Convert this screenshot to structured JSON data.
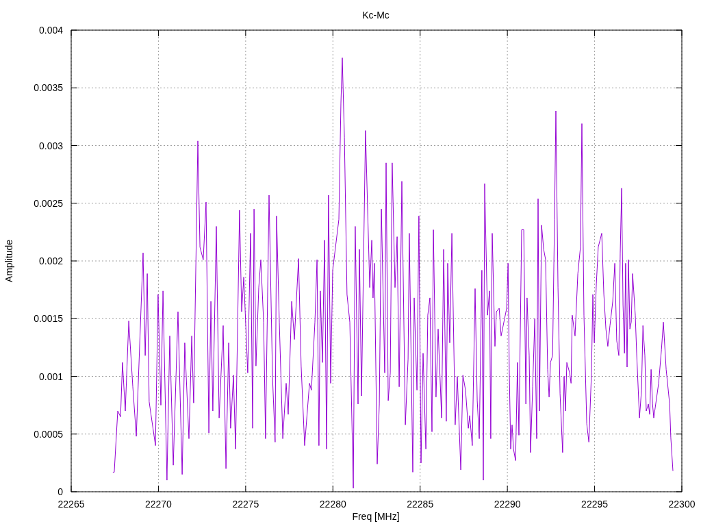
{
  "chart_data": {
    "type": "line",
    "title": "Kc-Mc",
    "xlabel": "Freq [MHz]",
    "ylabel": "Amplitude",
    "grid": true,
    "xlim": [
      22265,
      22300
    ],
    "ylim": [
      0,
      0.004
    ],
    "xticks": [
      22265,
      22270,
      22275,
      22280,
      22285,
      22290,
      22295,
      22300
    ],
    "yticks": [
      0,
      0.0005,
      0.001,
      0.0015,
      0.002,
      0.0025,
      0.003,
      0.0035,
      0.004
    ],
    "x": [
      22267.39,
      22267.47,
      22267.67,
      22267.83,
      22267.94,
      22268.1,
      22268.3,
      22268.53,
      22268.73,
      22269.12,
      22269.24,
      22269.36,
      22269.47,
      22269.83,
      22269.98,
      22270.14,
      22270.26,
      22270.49,
      22270.65,
      22270.85,
      22271.12,
      22271.36,
      22271.51,
      22271.75,
      22271.91,
      22272.02,
      22272.26,
      22272.38,
      22272.57,
      22272.73,
      22272.89,
      22273.01,
      22273.12,
      22273.32,
      22273.48,
      22273.71,
      22273.87,
      22274.03,
      22274.14,
      22274.3,
      22274.42,
      22274.65,
      22274.77,
      22274.89,
      22275.12,
      22275.28,
      22275.4,
      22275.48,
      22275.59,
      22275.75,
      22275.87,
      22276.03,
      22276.14,
      22276.34,
      22276.54,
      22276.69,
      22276.77,
      22276.93,
      22277.13,
      22277.32,
      22277.44,
      22277.64,
      22277.79,
      22278.03,
      22278.18,
      22278.38,
      22278.66,
      22278.77,
      22278.97,
      22279.09,
      22279.2,
      22279.28,
      22279.4,
      22279.52,
      22279.64,
      22279.75,
      22279.87,
      22279.99,
      22280.34,
      22280.46,
      22280.54,
      22280.66,
      22280.81,
      22280.97,
      22281.17,
      22281.28,
      22281.44,
      22281.52,
      22281.64,
      22281.87,
      22282.11,
      22282.23,
      22282.3,
      22282.38,
      22282.54,
      22282.66,
      22282.78,
      22282.97,
      22283.05,
      22283.17,
      22283.29,
      22283.4,
      22283.56,
      22283.68,
      22283.8,
      22283.95,
      22284.15,
      22284.31,
      22284.38,
      22284.58,
      22284.66,
      22284.82,
      22284.93,
      22285.05,
      22285.17,
      22285.33,
      22285.44,
      22285.56,
      22285.68,
      22285.76,
      22285.91,
      22286.03,
      22286.23,
      22286.35,
      22286.5,
      22286.58,
      22286.7,
      22286.82,
      22287.01,
      22287.13,
      22287.33,
      22287.45,
      22287.6,
      22287.76,
      22287.84,
      22287.99,
      22288.15,
      22288.27,
      22288.39,
      22288.54,
      22288.62,
      22288.7,
      22288.86,
      22288.98,
      22289.05,
      22289.13,
      22289.29,
      22289.37,
      22289.53,
      22289.64,
      22289.96,
      22290.04,
      22290.11,
      22290.19,
      22290.27,
      22290.35,
      22290.47,
      22290.58,
      22290.66,
      22290.82,
      22290.94,
      22291.06,
      22291.13,
      22291.25,
      22291.33,
      22291.45,
      22291.57,
      22291.68,
      22291.76,
      22291.84,
      22291.96,
      22292.08,
      22292.19,
      22292.31,
      22292.39,
      22292.47,
      22292.59,
      22292.7,
      22292.78,
      22292.9,
      22293.02,
      22293.17,
      22293.25,
      22293.33,
      22293.41,
      22293.57,
      22293.65,
      22293.72,
      22293.88,
      22294.04,
      22294.19,
      22294.27,
      22294.39,
      22294.55,
      22294.67,
      22294.82,
      22294.9,
      22294.98,
      22295.1,
      22295.21,
      22295.41,
      22295.53,
      22295.65,
      22295.76,
      22295.88,
      22296.04,
      22296.16,
      22296.27,
      22296.39,
      22296.47,
      22296.55,
      22296.63,
      22296.71,
      22296.78,
      22296.86,
      22296.94,
      22297.02,
      22297.1,
      22297.18,
      22297.33,
      22297.41,
      22297.57,
      22297.69,
      22297.77,
      22297.88,
      22297.96,
      22298.08,
      22298.16,
      22298.24,
      22298.32,
      22298.39,
      22298.67,
      22298.83,
      22298.94,
      22299.1,
      22299.3,
      22299.37,
      22299.49
    ],
    "series": [
      {
        "color": "#9400d3",
        "values": [
          0.00017,
          0.00017,
          0.0007,
          0.00065,
          0.00112,
          0.0007,
          0.00148,
          0.00091,
          0.00048,
          0.00207,
          0.00118,
          0.00189,
          0.00078,
          0.0004,
          0.00171,
          0.00075,
          0.00174,
          0.0001,
          0.00135,
          0.00023,
          0.00156,
          0.00015,
          0.00129,
          0.00046,
          0.00135,
          0.00077,
          0.00304,
          0.00212,
          0.00201,
          0.00251,
          0.00051,
          0.00165,
          0.0007,
          0.0023,
          0.00064,
          0.00144,
          0.0002,
          0.00129,
          0.00055,
          0.00101,
          0.00037,
          0.00244,
          0.00156,
          0.00186,
          0.00103,
          0.00224,
          0.00055,
          0.00245,
          0.00109,
          0.00177,
          0.00201,
          0.00147,
          0.00046,
          0.00257,
          0.00099,
          0.00043,
          0.00239,
          0.00147,
          0.00046,
          0.00094,
          0.00067,
          0.00165,
          0.00132,
          0.00202,
          0.00109,
          0.0004,
          0.00094,
          0.00088,
          0.00147,
          0.00201,
          0.0004,
          0.00174,
          0.00112,
          0.00218,
          0.00037,
          0.00257,
          0.00094,
          0.00192,
          0.00236,
          0.00337,
          0.00376,
          0.00307,
          0.00171,
          0.00147,
          3e-05,
          0.0023,
          0.00076,
          0.0021,
          0.00083,
          0.00313,
          0.00177,
          0.00218,
          0.00168,
          0.00198,
          0.00024,
          0.00076,
          0.00245,
          0.00103,
          0.00285,
          0.00079,
          0.00103,
          0.00285,
          0.00177,
          0.00221,
          0.00091,
          0.00269,
          0.00058,
          0.00115,
          0.00224,
          0.00017,
          0.00168,
          0.00088,
          0.00239,
          0.00025,
          0.0012,
          0.00037,
          0.00153,
          0.00168,
          0.00052,
          0.00227,
          0.00082,
          0.00141,
          0.00064,
          0.0021,
          0.00061,
          0.00198,
          0.00129,
          0.00224,
          0.00058,
          0.001,
          0.00019,
          0.00101,
          0.00088,
          0.00055,
          0.00066,
          0.0004,
          0.00176,
          0.00079,
          0.00046,
          0.00192,
          0.0001,
          0.00267,
          0.00153,
          0.00174,
          0.00046,
          0.00224,
          0.00126,
          0.00156,
          0.00159,
          0.00135,
          0.00159,
          0.00198,
          0.00106,
          0.00037,
          0.00058,
          0.00037,
          0.00027,
          0.00112,
          0.00049,
          0.00227,
          0.00227,
          0.00076,
          0.00168,
          0.00118,
          0.00034,
          0.00091,
          0.0015,
          0.00046,
          0.00254,
          0.0007,
          0.00231,
          0.0021,
          0.00201,
          0.00106,
          0.00082,
          0.00112,
          0.00118,
          0.00236,
          0.0033,
          0.00177,
          0.00085,
          0.00034,
          0.001,
          0.0007,
          0.00112,
          0.00103,
          0.00094,
          0.00153,
          0.00135,
          0.00189,
          0.00212,
          0.00319,
          0.00153,
          0.00059,
          0.00043,
          0.00103,
          0.00171,
          0.00129,
          0.0018,
          0.00212,
          0.00224,
          0.00171,
          0.00141,
          0.00126,
          0.00144,
          0.00165,
          0.00198,
          0.00131,
          0.00118,
          0.00207,
          0.00263,
          0.00162,
          0.0012,
          0.00198,
          0.00108,
          0.00201,
          0.00141,
          0.00147,
          0.00189,
          0.00153,
          0.0012,
          0.00064,
          0.00088,
          0.00144,
          0.00118,
          0.0007,
          0.00076,
          0.00067,
          0.00106,
          0.00076,
          0.00064,
          0.00094,
          0.00123,
          0.00147,
          0.00106,
          0.00076,
          0.00047,
          0.00018
        ]
      }
    ]
  }
}
